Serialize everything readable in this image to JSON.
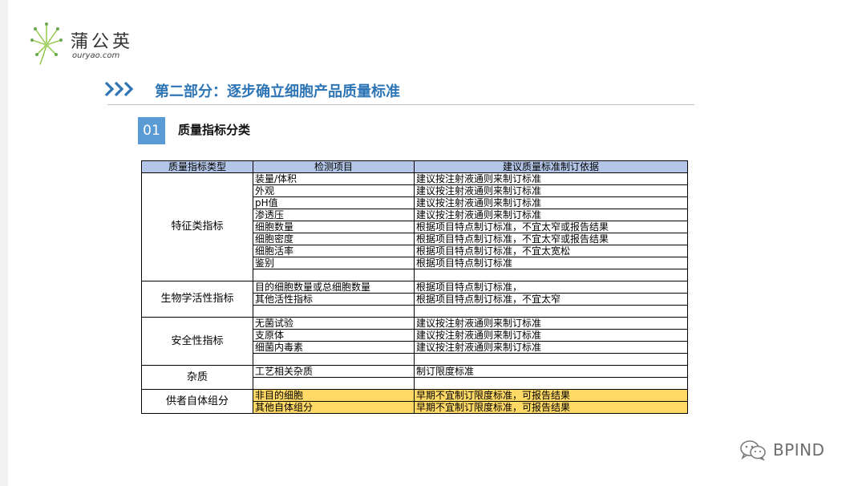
{
  "logo": {
    "cn": "蒲公英",
    "en": "ouryao.com"
  },
  "section": {
    "title": "第二部分：逐步确立细胞产品质量标准"
  },
  "subsection": {
    "number": "01",
    "title": "质量指标分类"
  },
  "table": {
    "headers": [
      "质量指标类型",
      "检测项目",
      "建议质量标准制订依据"
    ],
    "groups": [
      {
        "category": "特征类指标",
        "rows": [
          {
            "item": "装量/体积",
            "basis": "建议按注射液通则来制订标准"
          },
          {
            "item": "外观",
            "basis": "建议按注射液通则来制订标准"
          },
          {
            "item": "pH值",
            "basis": "建议按注射液通则来制订标准"
          },
          {
            "item": "渗透压",
            "basis": "建议按注射液通则来制订标准"
          },
          {
            "item": "细胞数量",
            "basis": "根据项目特点制订标准，不宜太窄或报告结果"
          },
          {
            "item": "细胞密度",
            "basis": "根据项目特点制订标准，不宜太窄或报告结果"
          },
          {
            "item": "细胞活率",
            "basis": "根据项目特点制订标准，不宜太宽松"
          },
          {
            "item": "鉴别",
            "basis": "根据项目特点制订标准"
          },
          {
            "item": "",
            "basis": ""
          }
        ]
      },
      {
        "category": "生物学活性指标",
        "rows": [
          {
            "item": "目的细胞数量或总细胞数量",
            "basis": "根据项目特点制订标准，"
          },
          {
            "item": "其他活性指标",
            "basis": "根据项目特点制订标准，不宜太窄"
          },
          {
            "item": "",
            "basis": ""
          }
        ]
      },
      {
        "category": "安全性指标",
        "rows": [
          {
            "item": "无菌试验",
            "basis": "建议按注射液通则来制订标准"
          },
          {
            "item": "支原体",
            "basis": "建议按注射液通则来制订标准"
          },
          {
            "item": "细菌内毒素",
            "basis": "建议按注射液通则来制订标准"
          },
          {
            "item": "",
            "basis": ""
          }
        ]
      },
      {
        "category": "杂质",
        "rows": [
          {
            "item": "工艺相关杂质",
            "basis": "制订限度标准"
          },
          {
            "item": "",
            "basis": ""
          }
        ]
      },
      {
        "category": "供者自体组分",
        "highlight": true,
        "rows": [
          {
            "item": "非目的细胞",
            "basis": "早期不宜制订限度标准，可报告结果"
          },
          {
            "item": "其他自体组分",
            "basis": "早期不宜制订限度标准，可报告结果"
          }
        ]
      }
    ]
  },
  "watermark": {
    "text": "BPIND"
  },
  "colors": {
    "accent": "#2e75b6",
    "num_box": "#5b9bd5",
    "header_fill": "#b4c6e7",
    "highlight_fill": "#ffd966"
  },
  "icons": [
    "dandelion-logo-icon",
    "triple-chevron-icon",
    "wechat-icon"
  ]
}
